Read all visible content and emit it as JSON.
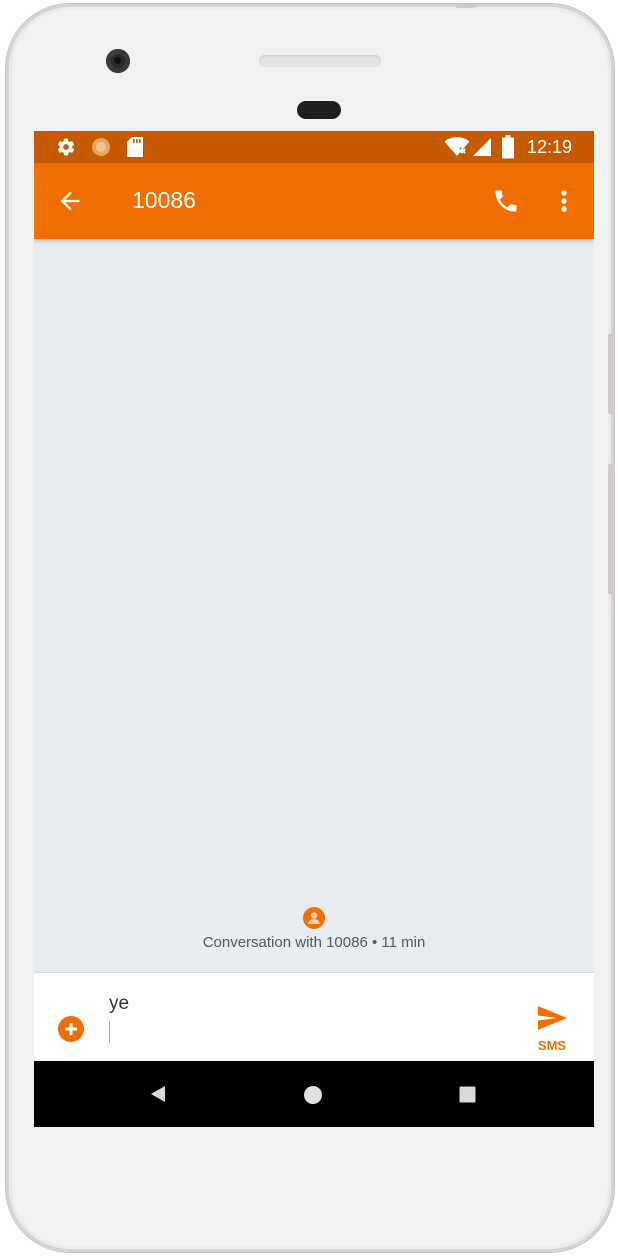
{
  "status_bar": {
    "time": "12:19",
    "icons": [
      "settings-icon",
      "loading-icon",
      "sd-card-icon",
      "wifi-off-icon",
      "signal-icon",
      "battery-icon"
    ]
  },
  "app_bar": {
    "title": "10086",
    "back_icon": "arrow-back-icon",
    "call_icon": "phone-icon",
    "menu_icon": "more-vert-icon"
  },
  "conversation": {
    "info_text": "Conversation with 10086 • 11 min",
    "avatar_icon": "person-icon"
  },
  "compose": {
    "value": "ye",
    "send_label": "SMS",
    "attach_icon": "add-circle-icon",
    "send_icon": "send-icon"
  },
  "navigation_bar": {
    "buttons": [
      "back-triangle-icon",
      "home-circle-icon",
      "recents-square-icon"
    ]
  },
  "colors": {
    "accent": "#f06f00",
    "status_bar": "#c55a00",
    "background": "#e9ecef"
  }
}
